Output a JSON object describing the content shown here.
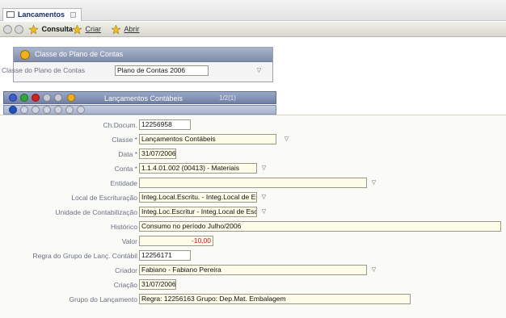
{
  "tab": {
    "title": "Lancamentos"
  },
  "toolbar": {
    "items": [
      {
        "label": "Consulta",
        "icon": "star-icon"
      },
      {
        "label": "Criar",
        "icon": "star-icon"
      },
      {
        "label": "Abrir",
        "icon": "star-icon"
      }
    ]
  },
  "plan_panel": {
    "title": "Classe do Plano de Contas",
    "field_label": "Classe do Plano de Contas",
    "field_value": "Plano de Contas 2006"
  },
  "section": {
    "title": "Lançamentos Contábeis",
    "count": "1/2(1)"
  },
  "form": {
    "fields": [
      {
        "label": "Ch.Docum.",
        "value": "12256958"
      },
      {
        "label": "Classe *",
        "value": "Lançamentos Contábeis"
      },
      {
        "label": "Data *",
        "value": "31/07/2006"
      },
      {
        "label": "Conta *",
        "value": "1.1.4.01.002 (00413) - Materiais"
      },
      {
        "label": "Entidade",
        "value": ""
      },
      {
        "label": "Local de Escrituração",
        "value": "Integ.Local.Escritu. - Integ.Local de Escrit"
      },
      {
        "label": "Unidade de Contabilização",
        "value": "Integ.Loc.Escritur - Integ.Local de Escrit"
      },
      {
        "label": "Histórico",
        "value": "Consumo no período Julho/2006"
      },
      {
        "label": "Valor",
        "value": "-10,00"
      },
      {
        "label": "Regra do Grupo de Lanç. Contábil",
        "value": "12256171"
      },
      {
        "label": "Criador",
        "value": "Fabiano - Fabiano Pereira"
      },
      {
        "label": "Criação",
        "value": "31/07/2006"
      },
      {
        "label": "Grupo do Lançamento",
        "value": "Regra: 12256163 Grupo: Dep.Mat. Embalagem"
      }
    ]
  },
  "colors": {
    "panel_header": "#7f8ca8",
    "field_bg": "#fcfce8",
    "label_text": "#6a6f86",
    "value_negative": "#cc1111"
  }
}
